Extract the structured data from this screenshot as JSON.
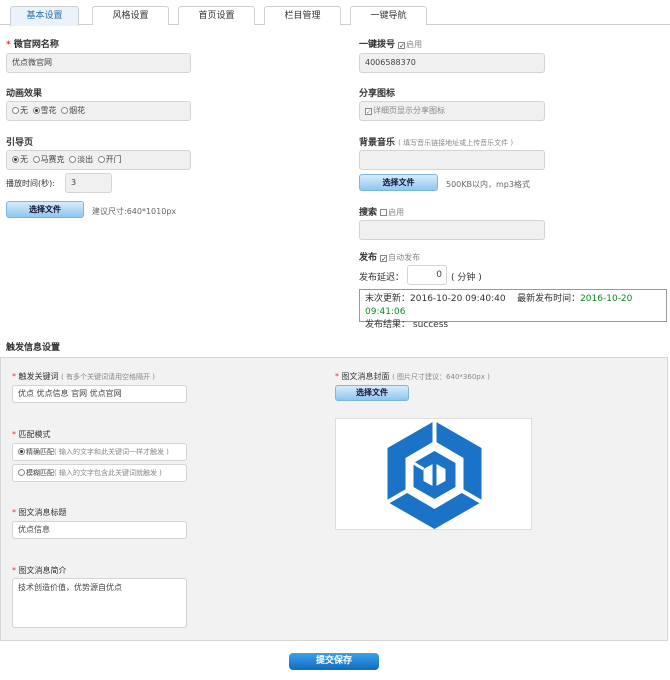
{
  "tabs": [
    {
      "label": "基本设置",
      "active": true
    },
    {
      "label": "风格设置"
    },
    {
      "label": "首页设置"
    },
    {
      "label": "栏目管理"
    },
    {
      "label": "一键导航"
    }
  ],
  "left": {
    "site_name_label": "微官网名称",
    "site_name_value": "优点微官网",
    "anim_label": "动画效果",
    "anim_options": [
      "无",
      "雪花",
      "烟花"
    ],
    "guide_label": "引导页",
    "guide_options": [
      "无",
      "马赛克",
      "淡出",
      "开门"
    ],
    "play_time_label": "播放时间(秒):",
    "play_time_value": "3",
    "choose_file": "选择文件",
    "size_hint": "建议尺寸:640*1010px"
  },
  "right": {
    "dial_label": "一键拨号",
    "dial_enable": "启用",
    "dial_value": "4006588370",
    "share_label": "分享图标",
    "share_check": "详细页显示分享图标",
    "music_label": "背景音乐",
    "music_note": "( 填写音乐链接地址或上传音乐文件 )",
    "music_choose": "选择文件",
    "music_hint": "500KB以内，mp3格式",
    "search_label": "搜索",
    "search_enable": "启用",
    "publish_label": "发布",
    "publish_auto": "自动发布",
    "delay_label": "发布延迟：",
    "delay_value": "0",
    "delay_unit": "( 分钟 )",
    "last_update_label": "末次更新：",
    "last_update": "2016-10-20 09:40:40",
    "latest_label": "最新发布时间：",
    "latest_time": "2016-10-20 09:41:06",
    "result_label": "发布结果：",
    "result_value": "success"
  },
  "trigger": {
    "title": "触发信息设置",
    "keyword_label": "触发关键词",
    "keyword_note": "( 有多个关键词请用空格隔开 )",
    "keyword_value": "优点 优点信息 官网 优点官网",
    "match_label": "匹配模式",
    "match_exact": "精确匹配",
    "match_exact_note": "( 输入的文字和此关键词一样才触发 )",
    "match_fuzzy": "模糊匹配",
    "match_fuzzy_note": "( 输入的文字包含此关键词就触发 )",
    "msg_title_label": "图文消息标题",
    "msg_title_value": "优点信息",
    "msg_intro_label": "图文消息简介",
    "msg_intro_value": "技术创造价值，优势源自优点",
    "cover_label": "图文消息封面",
    "cover_note": "( 图片尺寸建议：640*360px )",
    "cover_choose": "选择文件",
    "logo_color": "#1a73c7"
  },
  "submit": "提交保存"
}
